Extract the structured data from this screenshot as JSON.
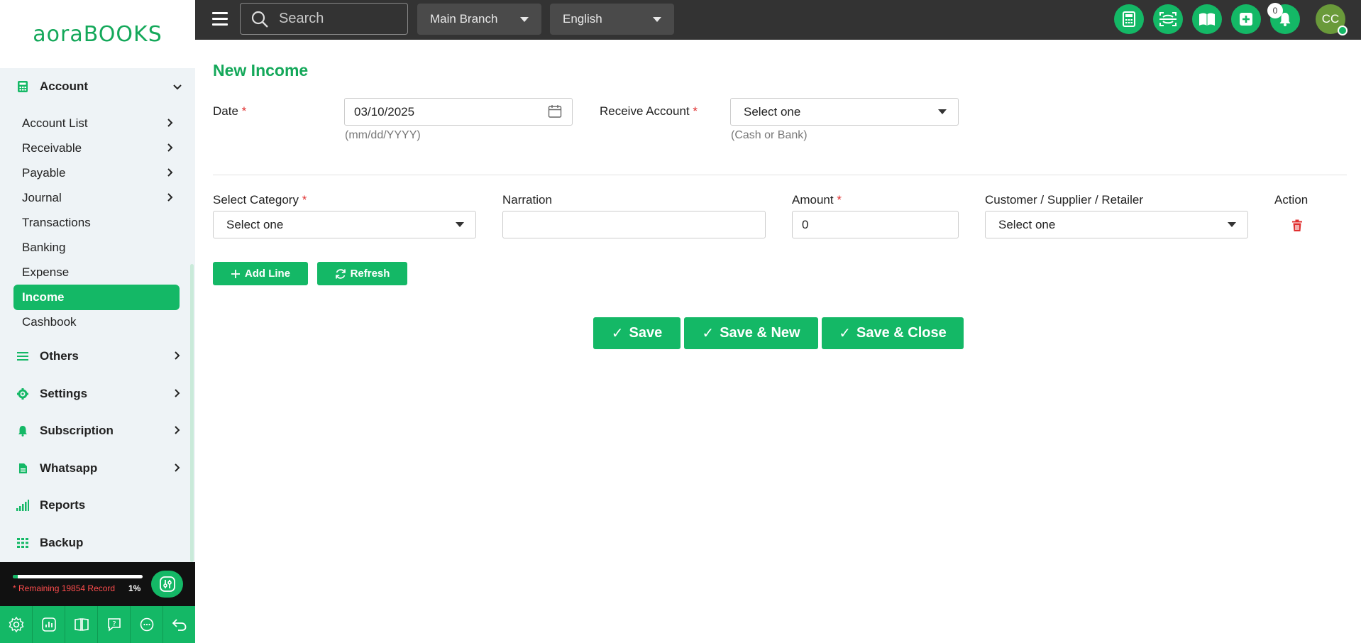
{
  "brand": {
    "logo_part1": "aora",
    "logo_part2": "BOOKS"
  },
  "topbar": {
    "search_placeholder": "Search",
    "branch": "Main Branch",
    "language": "English",
    "notification_count": "0",
    "avatar_initials": "CC"
  },
  "sidebar": {
    "account": {
      "label": "Account",
      "items": [
        {
          "label": "Account List",
          "has_children": true
        },
        {
          "label": "Receivable",
          "has_children": true
        },
        {
          "label": "Payable",
          "has_children": true
        },
        {
          "label": "Journal",
          "has_children": true
        },
        {
          "label": "Transactions",
          "has_children": false
        },
        {
          "label": "Banking",
          "has_children": false
        },
        {
          "label": "Expense",
          "has_children": false
        },
        {
          "label": "Income",
          "has_children": false,
          "active": true
        },
        {
          "label": "Cashbook",
          "has_children": false
        }
      ]
    },
    "sections": [
      {
        "label": "Others",
        "icon": "list-icon"
      },
      {
        "label": "Settings",
        "icon": "gear-icon"
      },
      {
        "label": "Subscription",
        "icon": "bell-icon"
      },
      {
        "label": "Whatsapp",
        "icon": "document-icon"
      },
      {
        "label": "Reports",
        "icon": "bar-chart-icon"
      },
      {
        "label": "Backup",
        "icon": "grid-icon"
      }
    ],
    "usage": {
      "note": "* Remaining 19854 Record",
      "percent_label": "1%",
      "percent": 1
    }
  },
  "form": {
    "title": "New Income",
    "date_label": "Date",
    "date_value": "03/10/2025",
    "date_hint": "(mm/dd/YYYY)",
    "receive_account_label": "Receive Account",
    "receive_account_value": "Select one",
    "receive_account_hint": "(Cash or Bank)",
    "columns": {
      "category": "Select Category",
      "narration": "Narration",
      "amount": "Amount",
      "party": "Customer / Supplier / Retailer",
      "action": "Action"
    },
    "line": {
      "category": "Select one",
      "narration": "",
      "amount": "0",
      "party": "Select one"
    },
    "add_line_label": "Add Line",
    "refresh_label": "Refresh",
    "save_label": "Save",
    "save_new_label": "Save & New",
    "save_close_label": "Save & Close",
    "required_mark": "*"
  },
  "colors": {
    "accent": "#14b866",
    "topbar": "#333333",
    "required": "#e03030",
    "delete": "#e03030"
  }
}
